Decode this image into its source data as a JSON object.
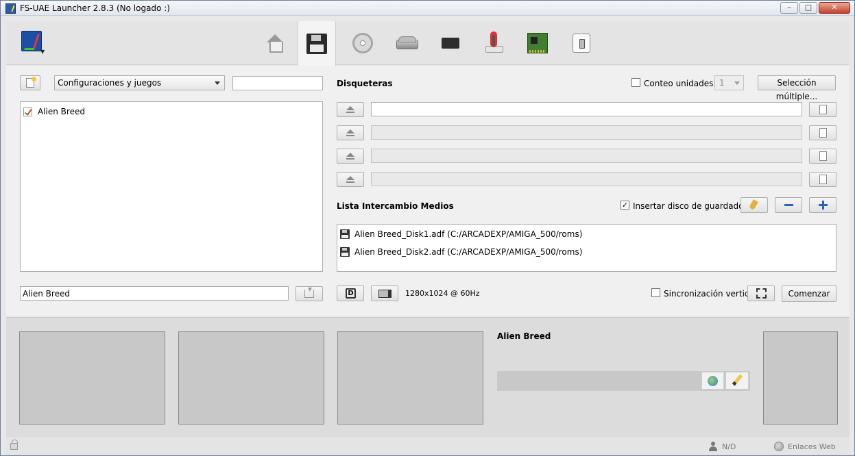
{
  "window": {
    "title": "FS-UAE Launcher 2.8.3 (No logado :)",
    "min_glyph": "–",
    "max_glyph": "□",
    "close_glyph": "✕"
  },
  "toolbar": {
    "tabs": [
      "home",
      "floppies",
      "cdroms",
      "hard-drives",
      "roms-memory",
      "input",
      "expansions",
      "additional-config"
    ],
    "active_tab": "floppies"
  },
  "left": {
    "config_select": "Configuraciones y juegos",
    "search_value": "",
    "games": [
      "Alien Breed"
    ],
    "game_name_value": "Alien Breed"
  },
  "floppies": {
    "section_title": "Disqueteras",
    "drive_count_label": "Conteo unidades:",
    "drive_count_value": "1",
    "drive_count_checked": false,
    "multi_select_label": "Selección múltiple...",
    "drives": [
      "",
      "",
      "",
      ""
    ]
  },
  "media_swap": {
    "section_title": "Lista Intercambio Medios",
    "insert_save_label": "Insertar disco de guardado",
    "insert_save_checked": true,
    "items": [
      "Alien Breed_Disk1.adf (C:/ARCADEXP/AMIGA_500/roms)",
      "Alien Breed_Disk2.adf (C:/ARCADEXP/AMIGA_500/roms)"
    ]
  },
  "run": {
    "display_glyph": "D",
    "resolution": "1280x1024 @ 60Hz",
    "vsync_label": "Sincronización vertical",
    "vsync_checked": false,
    "start_label": "Comenzar"
  },
  "info": {
    "game_title": "Alien Breed"
  },
  "status": {
    "user": "N/D",
    "web_links": "Enlaces Web"
  }
}
